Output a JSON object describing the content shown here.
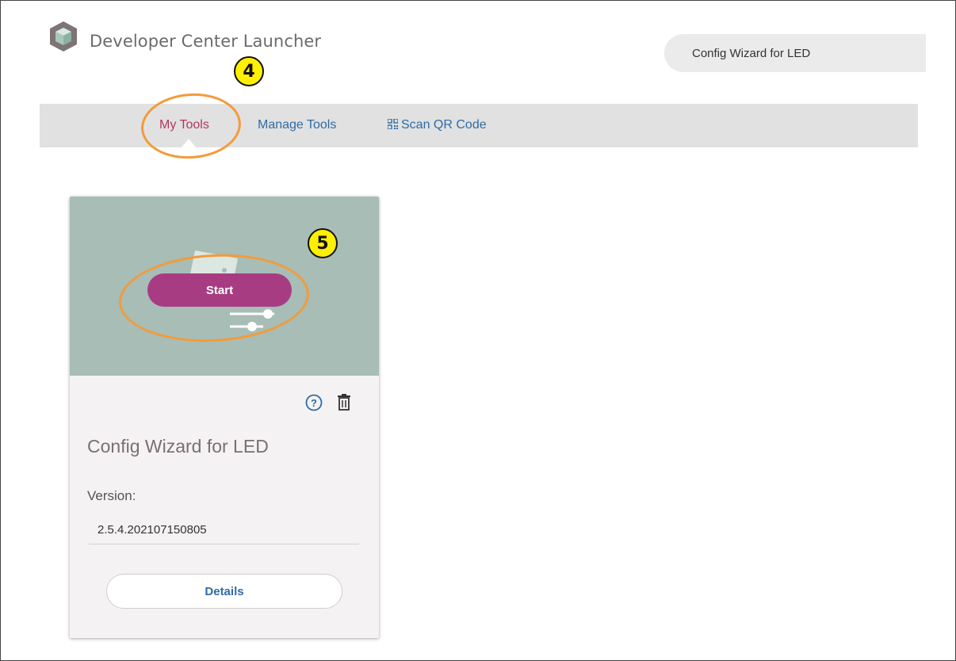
{
  "header": {
    "app_title": "Developer Center Launcher",
    "search_value": "Config Wizard for LED",
    "logo_icon": "cube-logo-icon"
  },
  "nav": {
    "tabs": [
      {
        "label": "My Tools",
        "active": true
      },
      {
        "label": "Manage Tools",
        "active": false
      },
      {
        "label": "Scan QR Code",
        "active": false,
        "icon": "qr-code-icon"
      }
    ]
  },
  "annotations": {
    "step_nav": "4",
    "step_start": "5"
  },
  "card": {
    "start_label": "Start",
    "tool_name": "Config Wizard for LED",
    "version_label": "Version:",
    "version_value": "2.5.4.202107150805",
    "details_label": "Details",
    "help_icon": "help-icon",
    "delete_icon": "trash-icon"
  },
  "colors": {
    "accent_active": "#b3385f",
    "link": "#2e6ca6",
    "start_button": "#a83c83",
    "banner": "#a7bdb5",
    "annotation_badge": "#ffef00",
    "annotation_ring": "#f39b3a"
  }
}
